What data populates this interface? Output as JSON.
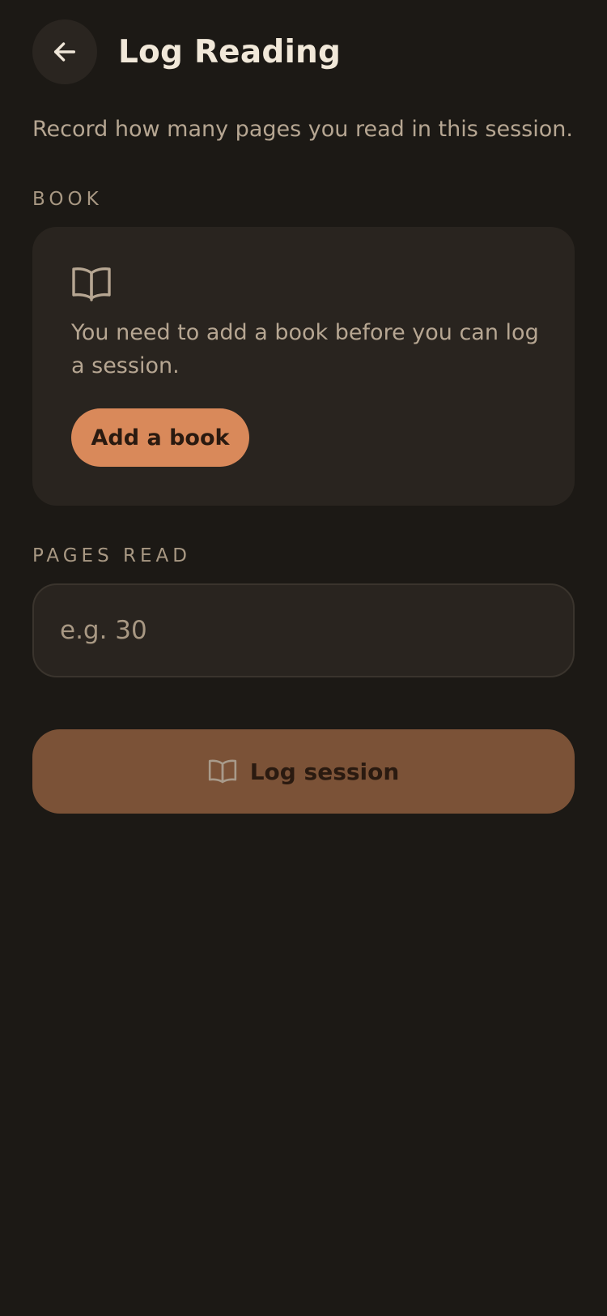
{
  "header": {
    "title": "Log Reading",
    "back_icon": "arrow-left-icon"
  },
  "subtitle": "Record how many pages you read in this session.",
  "book_section": {
    "label": "BOOK",
    "icon": "open-book-icon",
    "empty_message": "You need to add a book before you can log a session.",
    "add_button_label": "Add a book"
  },
  "pages_section": {
    "label": "PAGES READ",
    "input_value": "",
    "placeholder": "e.g. 30"
  },
  "submit": {
    "label": "Log session",
    "icon": "open-book-icon"
  },
  "colors": {
    "background": "#1c1915",
    "card": "#29241f",
    "accent": "#d9895a",
    "accent_disabled": "#7b5237",
    "text_primary": "#f1e8d9",
    "text_muted": "#b6a692"
  }
}
